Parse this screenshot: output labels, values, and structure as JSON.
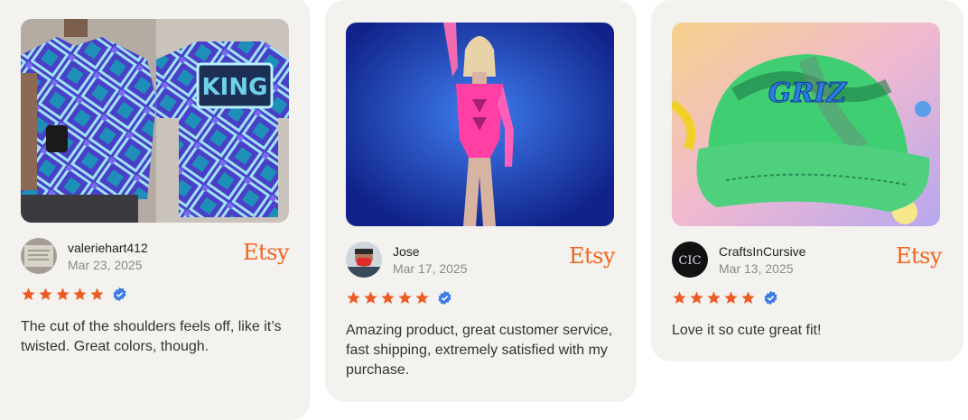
{
  "brand": {
    "name": "Etsy",
    "color": "#f1641e"
  },
  "accent": {
    "star": "#ee5a24",
    "verified": "#3b7be8"
  },
  "reviews": [
    {
      "username": "valeriehart412",
      "date": "Mar 23, 2025",
      "rating": 5,
      "verified": true,
      "text": "The cut of the shoulders feels off, like it’s twisted. Great colors, though.",
      "image": "king-pattern-tshirt-photo",
      "avatar": "book-avatar"
    },
    {
      "username": "Jose",
      "date": "Mar 17, 2025",
      "rating": 5,
      "verified": true,
      "text": "Amazing product, great customer service, fast shipping, extremely satisfied with my purchase.",
      "image": "neon-pink-bodysuit-photo",
      "avatar": "person-mask-avatar"
    },
    {
      "username": "CraftsInCursive",
      "date": "Mar 13, 2025",
      "rating": 5,
      "verified": true,
      "text": "Love it so cute great fit!",
      "image": "griz-tie-dye-cap-photo",
      "avatar": "cic-logo-avatar"
    }
  ]
}
